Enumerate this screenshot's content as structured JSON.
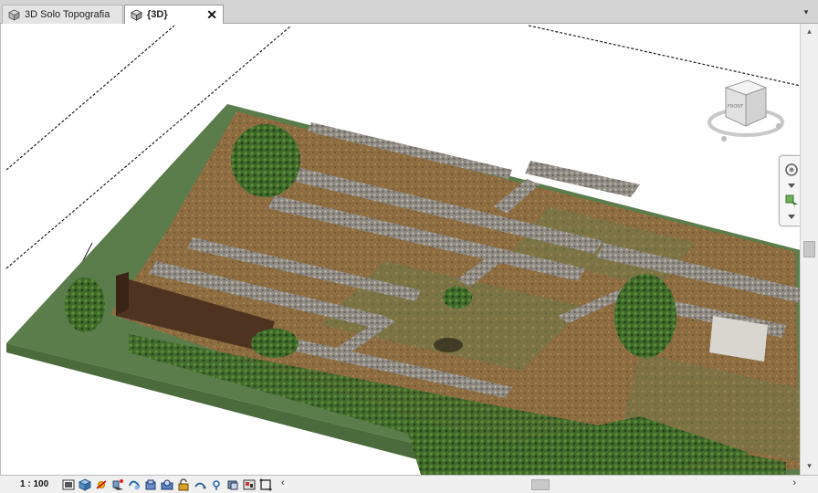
{
  "tabs": [
    {
      "label": "3D  Solo Topografia",
      "active": false,
      "icon": "view3d-icon"
    },
    {
      "label": "{3D}",
      "active": true,
      "icon": "view3d-icon",
      "close": "✕"
    }
  ],
  "tab_overflow": "▾",
  "status": {
    "scale": "1 : 100",
    "view_controls": [
      "detail-level-icon",
      "visual-style-icon",
      "sun-path-icon",
      "shadows-icon",
      "rendering-dialog-icon",
      "crop-view-icon",
      "show-crop-region-icon",
      "unlock-3d-view-icon",
      "temporary-hide-isolate-icon",
      "reveal-hidden-elements-icon",
      "worksharing-display-icon",
      "temporary-view-properties-icon",
      "analytical-model-icon"
    ],
    "scroll_left": "‹",
    "scroll_right": "›"
  },
  "viewcube": {
    "face_label": "FRONT"
  },
  "vscroll": {
    "up": "▴",
    "down": "▾"
  },
  "colors": {
    "ground": "#5a7a4a",
    "ruins_earth": "#8a6a3e",
    "stone": "#9a948a",
    "accent_tab": "#ffffff"
  }
}
